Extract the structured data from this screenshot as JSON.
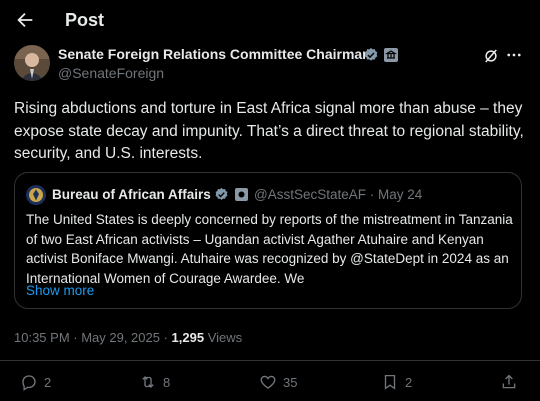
{
  "header": {
    "title": "Post"
  },
  "post": {
    "author_name": "Senate Foreign Relations Committee Chairman",
    "handle": "@SenateForeign",
    "text": "Rising abductions and torture in East Africa signal more than abuse – they expose state decay and impunity. That’s a direct threat to regional stability, security, and U.S. interests.",
    "timestamp": "10:35 PM · May 29, 2025 · ",
    "views_count": "1,295",
    "views_label": " Views"
  },
  "quote": {
    "author_name": "Bureau of African Affairs",
    "handle_date": "@AsstSecStateAF · May 24",
    "text": "The United States is deeply concerned by reports of the mistreatment in Tanzania of two East African activists – Ugandan activist Agather Atuhaire and Kenyan activist Boniface Mwangi.  Atuhaire was recognized by @StateDept in 2024 as an International Women of Courage Awardee.  We",
    "show_more": "Show more"
  },
  "actions": {
    "replies": "2",
    "reposts": "8",
    "likes": "35",
    "bookmarks": "2"
  },
  "colors": {
    "background": "#000000",
    "text": "#e7e9ea",
    "muted": "#71767b",
    "accent": "#1d9bf0",
    "border": "#2f3336"
  }
}
